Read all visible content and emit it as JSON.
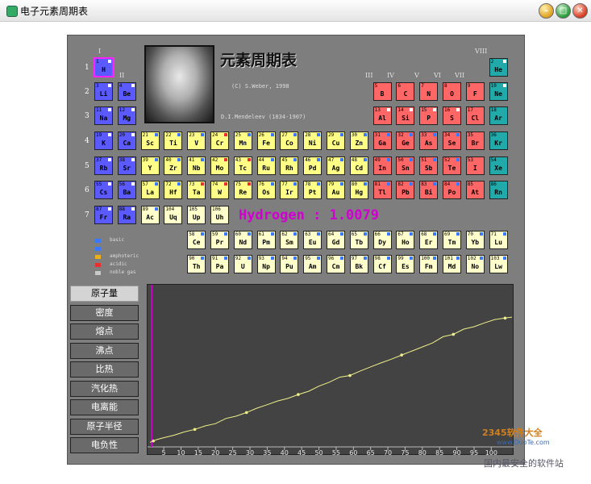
{
  "window": {
    "title": "电子元素周期表"
  },
  "heading": "元素周期表",
  "copyright": "(C) S.Weber, 1998",
  "mendeleev": "D.I.Mendeleev (1834-1907)",
  "readout": "Hydrogen : 1.0079",
  "group_labels": [
    "I",
    "II",
    "III",
    "IV",
    "V",
    "VI",
    "VII",
    "VIII"
  ],
  "period_labels": [
    "1",
    "2",
    "3",
    "4",
    "5",
    "6",
    "7"
  ],
  "colors": {
    "basic": "#5a5aff",
    "amphoteric": "#ffff88",
    "acidic": "#ff6666",
    "noble": "#22aaaa",
    "rare": "#ffffcc",
    "marker_blue": "#3a78ff",
    "marker_red": "#e83030"
  },
  "legend": [
    {
      "label": "basic",
      "color": "#3a78ff"
    },
    {
      "label": "",
      "color": "#3a78ff"
    },
    {
      "label": "amphoteric",
      "color": "#e8b020"
    },
    {
      "label": "acidic",
      "color": "#e83030"
    },
    {
      "label": "noble gas",
      "color": "#c8c8c8"
    }
  ],
  "elements": [
    {
      "n": "1",
      "s": "H",
      "t": "basic",
      "mk": "w",
      "r": 0,
      "c": 0,
      "sel": true
    },
    {
      "n": "2",
      "s": "He",
      "t": "noble",
      "mk": "w",
      "r": 0,
      "c": 17
    },
    {
      "n": "3",
      "s": "Li",
      "t": "basic",
      "mk": "w",
      "r": 1,
      "c": 0
    },
    {
      "n": "4",
      "s": "Be",
      "t": "basic",
      "mk": "w",
      "r": 1,
      "c": 1
    },
    {
      "n": "5",
      "s": "B",
      "t": "acidic",
      "mk": "",
      "r": 1,
      "c": 12
    },
    {
      "n": "6",
      "s": "C",
      "t": "acidic",
      "mk": "",
      "r": 1,
      "c": 13
    },
    {
      "n": "7",
      "s": "N",
      "t": "acidic",
      "mk": "",
      "r": 1,
      "c": 14
    },
    {
      "n": "8",
      "s": "O",
      "t": "acidic",
      "mk": "",
      "r": 1,
      "c": 15
    },
    {
      "n": "9",
      "s": "F",
      "t": "acidic",
      "mk": "",
      "r": 1,
      "c": 16
    },
    {
      "n": "10",
      "s": "Ne",
      "t": "noble",
      "mk": "w",
      "r": 1,
      "c": 17
    },
    {
      "n": "11",
      "s": "Na",
      "t": "basic",
      "mk": "w",
      "r": 2,
      "c": 0
    },
    {
      "n": "12",
      "s": "Mg",
      "t": "basic",
      "mk": "w",
      "r": 2,
      "c": 1
    },
    {
      "n": "13",
      "s": "Al",
      "t": "acidic",
      "mk": "w",
      "r": 2,
      "c": 12
    },
    {
      "n": "14",
      "s": "Si",
      "t": "acidic",
      "mk": "w",
      "r": 2,
      "c": 13
    },
    {
      "n": "15",
      "s": "P",
      "t": "acidic",
      "mk": "w",
      "r": 2,
      "c": 14
    },
    {
      "n": "16",
      "s": "S",
      "t": "acidic",
      "mk": "w",
      "r": 2,
      "c": 15
    },
    {
      "n": "17",
      "s": "Cl",
      "t": "acidic",
      "mk": "",
      "r": 2,
      "c": 16
    },
    {
      "n": "18",
      "s": "Ar",
      "t": "noble",
      "mk": "",
      "r": 2,
      "c": 17
    },
    {
      "n": "19",
      "s": "K",
      "t": "basic",
      "mk": "w",
      "r": 3,
      "c": 0
    },
    {
      "n": "20",
      "s": "Ca",
      "t": "basic",
      "mk": "w",
      "r": 3,
      "c": 1
    },
    {
      "n": "21",
      "s": "Sc",
      "t": "amphoteric",
      "mk": "b",
      "r": 3,
      "c": 2
    },
    {
      "n": "22",
      "s": "Ti",
      "t": "amphoteric",
      "mk": "b",
      "r": 3,
      "c": 3
    },
    {
      "n": "23",
      "s": "V",
      "t": "amphoteric",
      "mk": "b",
      "r": 3,
      "c": 4
    },
    {
      "n": "24",
      "s": "Cr",
      "t": "amphoteric",
      "mk": "r",
      "r": 3,
      "c": 5
    },
    {
      "n": "25",
      "s": "Mn",
      "t": "amphoteric",
      "mk": "b",
      "r": 3,
      "c": 6
    },
    {
      "n": "26",
      "s": "Fe",
      "t": "amphoteric",
      "mk": "b",
      "r": 3,
      "c": 7
    },
    {
      "n": "27",
      "s": "Co",
      "t": "amphoteric",
      "mk": "b",
      "r": 3,
      "c": 8
    },
    {
      "n": "28",
      "s": "Ni",
      "t": "amphoteric",
      "mk": "b",
      "r": 3,
      "c": 9
    },
    {
      "n": "29",
      "s": "Cu",
      "t": "amphoteric",
      "mk": "b",
      "r": 3,
      "c": 10
    },
    {
      "n": "30",
      "s": "Zn",
      "t": "amphoteric",
      "mk": "b",
      "r": 3,
      "c": 11
    },
    {
      "n": "31",
      "s": "Ga",
      "t": "acidic",
      "mk": "b",
      "r": 3,
      "c": 12
    },
    {
      "n": "32",
      "s": "Ge",
      "t": "acidic",
      "mk": "b",
      "r": 3,
      "c": 13
    },
    {
      "n": "33",
      "s": "As",
      "t": "acidic",
      "mk": "b",
      "r": 3,
      "c": 14
    },
    {
      "n": "34",
      "s": "Se",
      "t": "acidic",
      "mk": "b",
      "r": 3,
      "c": 15
    },
    {
      "n": "35",
      "s": "Br",
      "t": "acidic",
      "mk": "",
      "r": 3,
      "c": 16
    },
    {
      "n": "36",
      "s": "Kr",
      "t": "noble",
      "mk": "",
      "r": 3,
      "c": 17
    },
    {
      "n": "37",
      "s": "Rb",
      "t": "basic",
      "mk": "w",
      "r": 4,
      "c": 0
    },
    {
      "n": "38",
      "s": "Sr",
      "t": "basic",
      "mk": "w",
      "r": 4,
      "c": 1
    },
    {
      "n": "39",
      "s": "Y",
      "t": "amphoteric",
      "mk": "b",
      "r": 4,
      "c": 2
    },
    {
      "n": "40",
      "s": "Zr",
      "t": "amphoteric",
      "mk": "b",
      "r": 4,
      "c": 3
    },
    {
      "n": "41",
      "s": "Nb",
      "t": "amphoteric",
      "mk": "b",
      "r": 4,
      "c": 4
    },
    {
      "n": "42",
      "s": "Mo",
      "t": "amphoteric",
      "mk": "r",
      "r": 4,
      "c": 5
    },
    {
      "n": "43",
      "s": "Tc",
      "t": "amphoteric",
      "mk": "r",
      "r": 4,
      "c": 6
    },
    {
      "n": "44",
      "s": "Ru",
      "t": "amphoteric",
      "mk": "b",
      "r": 4,
      "c": 7
    },
    {
      "n": "45",
      "s": "Rh",
      "t": "amphoteric",
      "mk": "b",
      "r": 4,
      "c": 8
    },
    {
      "n": "46",
      "s": "Pd",
      "t": "amphoteric",
      "mk": "b",
      "r": 4,
      "c": 9
    },
    {
      "n": "47",
      "s": "Ag",
      "t": "amphoteric",
      "mk": "b",
      "r": 4,
      "c": 10
    },
    {
      "n": "48",
      "s": "Cd",
      "t": "amphoteric",
      "mk": "b",
      "r": 4,
      "c": 11
    },
    {
      "n": "49",
      "s": "In",
      "t": "acidic",
      "mk": "b",
      "r": 4,
      "c": 12
    },
    {
      "n": "50",
      "s": "Sn",
      "t": "acidic",
      "mk": "b",
      "r": 4,
      "c": 13
    },
    {
      "n": "51",
      "s": "Sb",
      "t": "acidic",
      "mk": "b",
      "r": 4,
      "c": 14
    },
    {
      "n": "52",
      "s": "Te",
      "t": "acidic",
      "mk": "b",
      "r": 4,
      "c": 15
    },
    {
      "n": "53",
      "s": "I",
      "t": "acidic",
      "mk": "",
      "r": 4,
      "c": 16
    },
    {
      "n": "54",
      "s": "Xe",
      "t": "noble",
      "mk": "",
      "r": 4,
      "c": 17
    },
    {
      "n": "55",
      "s": "Cs",
      "t": "basic",
      "mk": "w",
      "r": 5,
      "c": 0
    },
    {
      "n": "56",
      "s": "Ba",
      "t": "basic",
      "mk": "w",
      "r": 5,
      "c": 1
    },
    {
      "n": "57",
      "s": "La",
      "t": "amphoteric",
      "mk": "b",
      "r": 5,
      "c": 2
    },
    {
      "n": "72",
      "s": "Hf",
      "t": "amphoteric",
      "mk": "b",
      "r": 5,
      "c": 3
    },
    {
      "n": "73",
      "s": "Ta",
      "t": "amphoteric",
      "mk": "r",
      "r": 5,
      "c": 4
    },
    {
      "n": "74",
      "s": "W",
      "t": "amphoteric",
      "mk": "r",
      "r": 5,
      "c": 5
    },
    {
      "n": "75",
      "s": "Re",
      "t": "amphoteric",
      "mk": "r",
      "r": 5,
      "c": 6
    },
    {
      "n": "76",
      "s": "Os",
      "t": "amphoteric",
      "mk": "b",
      "r": 5,
      "c": 7
    },
    {
      "n": "77",
      "s": "Ir",
      "t": "amphoteric",
      "mk": "b",
      "r": 5,
      "c": 8
    },
    {
      "n": "78",
      "s": "Pt",
      "t": "amphoteric",
      "mk": "b",
      "r": 5,
      "c": 9
    },
    {
      "n": "79",
      "s": "Au",
      "t": "amphoteric",
      "mk": "b",
      "r": 5,
      "c": 10
    },
    {
      "n": "80",
      "s": "Hg",
      "t": "amphoteric",
      "mk": "b",
      "r": 5,
      "c": 11
    },
    {
      "n": "81",
      "s": "Tl",
      "t": "acidic",
      "mk": "b",
      "r": 5,
      "c": 12
    },
    {
      "n": "82",
      "s": "Pb",
      "t": "acidic",
      "mk": "b",
      "r": 5,
      "c": 13
    },
    {
      "n": "83",
      "s": "Bi",
      "t": "acidic",
      "mk": "b",
      "r": 5,
      "c": 14
    },
    {
      "n": "84",
      "s": "Po",
      "t": "acidic",
      "mk": "b",
      "r": 5,
      "c": 15
    },
    {
      "n": "85",
      "s": "At",
      "t": "acidic",
      "mk": "",
      "r": 5,
      "c": 16
    },
    {
      "n": "86",
      "s": "Rn",
      "t": "noble",
      "mk": "",
      "r": 5,
      "c": 17
    },
    {
      "n": "87",
      "s": "Fr",
      "t": "basic",
      "mk": "w",
      "r": 6,
      "c": 0
    },
    {
      "n": "88",
      "s": "Ra",
      "t": "basic",
      "mk": "w",
      "r": 6,
      "c": 1
    },
    {
      "n": "89",
      "s": "Ac",
      "t": "rare",
      "mk": "b",
      "r": 6,
      "c": 2
    },
    {
      "n": "104",
      "s": "Uq",
      "t": "rare",
      "mk": "",
      "r": 6,
      "c": 3
    },
    {
      "n": "105",
      "s": "Up",
      "t": "rare",
      "mk": "",
      "r": 6,
      "c": 4
    },
    {
      "n": "106",
      "s": "Uh",
      "t": "rare",
      "mk": "",
      "r": 6,
      "c": 5
    },
    {
      "n": "58",
      "s": "Ce",
      "t": "rare",
      "mk": "b",
      "r": 7,
      "c": 4
    },
    {
      "n": "59",
      "s": "Pr",
      "t": "rare",
      "mk": "b",
      "r": 7,
      "c": 5
    },
    {
      "n": "60",
      "s": "Nd",
      "t": "rare",
      "mk": "b",
      "r": 7,
      "c": 6
    },
    {
      "n": "61",
      "s": "Pm",
      "t": "rare",
      "mk": "b",
      "r": 7,
      "c": 7
    },
    {
      "n": "62",
      "s": "Sm",
      "t": "rare",
      "mk": "b",
      "r": 7,
      "c": 8
    },
    {
      "n": "63",
      "s": "Eu",
      "t": "rare",
      "mk": "b",
      "r": 7,
      "c": 9
    },
    {
      "n": "64",
      "s": "Gd",
      "t": "rare",
      "mk": "b",
      "r": 7,
      "c": 10
    },
    {
      "n": "65",
      "s": "Tb",
      "t": "rare",
      "mk": "b",
      "r": 7,
      "c": 11
    },
    {
      "n": "66",
      "s": "Dy",
      "t": "rare",
      "mk": "b",
      "r": 7,
      "c": 12
    },
    {
      "n": "67",
      "s": "Ho",
      "t": "rare",
      "mk": "b",
      "r": 7,
      "c": 13
    },
    {
      "n": "68",
      "s": "Er",
      "t": "rare",
      "mk": "b",
      "r": 7,
      "c": 14
    },
    {
      "n": "69",
      "s": "Tm",
      "t": "rare",
      "mk": "b",
      "r": 7,
      "c": 15
    },
    {
      "n": "70",
      "s": "Yb",
      "t": "rare",
      "mk": "b",
      "r": 7,
      "c": 16
    },
    {
      "n": "71",
      "s": "Lu",
      "t": "rare",
      "mk": "b",
      "r": 7,
      "c": 17
    },
    {
      "n": "90",
      "s": "Th",
      "t": "rare",
      "mk": "b",
      "r": 8,
      "c": 4
    },
    {
      "n": "91",
      "s": "Pa",
      "t": "rare",
      "mk": "b",
      "r": 8,
      "c": 5
    },
    {
      "n": "92",
      "s": "U",
      "t": "rare",
      "mk": "b",
      "r": 8,
      "c": 6
    },
    {
      "n": "93",
      "s": "Np",
      "t": "rare",
      "mk": "b",
      "r": 8,
      "c": 7
    },
    {
      "n": "94",
      "s": "Pu",
      "t": "rare",
      "mk": "b",
      "r": 8,
      "c": 8
    },
    {
      "n": "95",
      "s": "Am",
      "t": "rare",
      "mk": "b",
      "r": 8,
      "c": 9
    },
    {
      "n": "96",
      "s": "Cm",
      "t": "rare",
      "mk": "b",
      "r": 8,
      "c": 10
    },
    {
      "n": "97",
      "s": "Bk",
      "t": "rare",
      "mk": "b",
      "r": 8,
      "c": 11
    },
    {
      "n": "98",
      "s": "Cf",
      "t": "rare",
      "mk": "b",
      "r": 8,
      "c": 12
    },
    {
      "n": "99",
      "s": "Es",
      "t": "rare",
      "mk": "b",
      "r": 8,
      "c": 13
    },
    {
      "n": "100",
      "s": "Fm",
      "t": "rare",
      "mk": "b",
      "r": 8,
      "c": 14
    },
    {
      "n": "101",
      "s": "Md",
      "t": "rare",
      "mk": "b",
      "r": 8,
      "c": 15
    },
    {
      "n": "102",
      "s": "No",
      "t": "rare",
      "mk": "b",
      "r": 8,
      "c": 16
    },
    {
      "n": "103",
      "s": "Lw",
      "t": "rare",
      "mk": "b",
      "r": 8,
      "c": 17
    }
  ],
  "properties": [
    {
      "label": "原子量",
      "active": true
    },
    {
      "label": "密度",
      "active": false
    },
    {
      "label": "熔点",
      "active": false
    },
    {
      "label": "沸点",
      "active": false
    },
    {
      "label": "比热",
      "active": false
    },
    {
      "label": "汽化热",
      "active": false
    },
    {
      "label": "电离能",
      "active": false
    },
    {
      "label": "原子半径",
      "active": false
    },
    {
      "label": "电负性",
      "active": false
    }
  ],
  "chart_data": {
    "type": "line",
    "title": "",
    "xlabel": "",
    "ylabel": "",
    "xlim": [
      1,
      106
    ],
    "ylim": [
      0,
      270
    ],
    "x_ticks": [
      5,
      10,
      15,
      20,
      25,
      30,
      35,
      40,
      45,
      50,
      55,
      60,
      65,
      70,
      75,
      80,
      85,
      90,
      95,
      100
    ],
    "series": [
      {
        "name": "",
        "x": [
          1,
          2,
          3,
          5,
          8,
          11,
          14,
          17,
          20,
          23,
          26,
          29,
          32,
          35,
          38,
          41,
          44,
          47,
          50,
          53,
          56,
          59,
          62,
          65,
          68,
          71,
          74,
          77,
          80,
          83,
          86,
          89,
          92,
          95,
          98,
          101,
          104,
          106
        ],
        "values": [
          1.0,
          4.0,
          6.9,
          10.8,
          16.0,
          23.0,
          28.1,
          35.5,
          40.1,
          50.9,
          55.8,
          63.5,
          72.6,
          79.9,
          87.6,
          92.9,
          101.1,
          107.9,
          118.7,
          126.9,
          137.3,
          140.9,
          150.4,
          158.9,
          167.3,
          175.0,
          183.8,
          192.2,
          200.6,
          209.0,
          222.0,
          227.0,
          238.0,
          243.0,
          251.0,
          258.0,
          261.0,
          263.0
        ]
      }
    ],
    "highlight": {
      "x": 1,
      "color": "#cc00cc"
    },
    "line_color": "#f0f08a"
  },
  "watermark": {
    "brand": "2345软件大全",
    "url": "www.DuoTe.com",
    "slogan": "国内最安全的软件站"
  }
}
